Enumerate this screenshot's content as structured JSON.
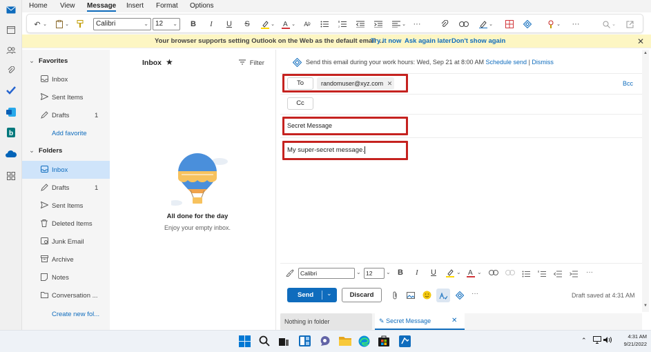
{
  "ribbon": {
    "tabs": [
      "Home",
      "View",
      "Message",
      "Insert",
      "Format",
      "Options"
    ],
    "active_tab": "Message",
    "font_name": "Calibri",
    "font_size": "12"
  },
  "banner": {
    "text": "Your browser supports setting Outlook on the Web as the default email ...",
    "try_it_now": "Try it now",
    "ask_again_later": "Ask again later",
    "dont_show_again": "Don't show again"
  },
  "folders": {
    "favorites_label": "Favorites",
    "favorites": [
      {
        "label": "Inbox",
        "icon": "inbox-icon",
        "count": ""
      },
      {
        "label": "Sent Items",
        "icon": "send-icon",
        "count": ""
      },
      {
        "label": "Drafts",
        "icon": "pencil-icon",
        "count": "1"
      }
    ],
    "add_favorite": "Add favorite",
    "folders_label": "Folders",
    "items": [
      {
        "label": "Inbox",
        "icon": "inbox-icon",
        "count": ""
      },
      {
        "label": "Drafts",
        "icon": "pencil-icon",
        "count": "1"
      },
      {
        "label": "Sent Items",
        "icon": "send-icon",
        "count": ""
      },
      {
        "label": "Deleted Items",
        "icon": "trash-icon",
        "count": ""
      },
      {
        "label": "Junk Email",
        "icon": "junk-icon",
        "count": ""
      },
      {
        "label": "Archive",
        "icon": "archive-icon",
        "count": ""
      },
      {
        "label": "Notes",
        "icon": "note-icon",
        "count": ""
      },
      {
        "label": "Conversation ...",
        "icon": "folder-icon",
        "count": ""
      }
    ],
    "create_new": "Create new fol..."
  },
  "message_list": {
    "title": "Inbox",
    "filter": "Filter",
    "empty_title": "All done for the day",
    "empty_subtitle": "Enjoy your empty inbox."
  },
  "compose": {
    "schedule_text": "Send this email during your work hours: Wed, Sep 21 at 8:00 AM",
    "schedule_send": "Schedule send",
    "separator": "|",
    "dismiss": "Dismiss",
    "to_label": "To",
    "recipient": "randomuser@xyz.com",
    "cc_label": "Cc",
    "bcc_label": "Bcc",
    "subject": "Secret Message",
    "body": "My super-secret message.",
    "font_name": "Calibri",
    "font_size": "12",
    "send": "Send",
    "discard": "Discard",
    "draft_saved": "Draft saved at 4:31 AM"
  },
  "bottom_tabs": {
    "nothing_in_folder": "Nothing in folder",
    "draft_tab": "Secret Message"
  },
  "taskbar": {
    "time": "4:31 AM",
    "date": "9/21/2022"
  },
  "colors": {
    "accent": "#0f6cbd",
    "highlight_border": "#c5221f",
    "banner_bg": "#fdf6c3",
    "selected_folder_bg": "#cfe4fa"
  }
}
